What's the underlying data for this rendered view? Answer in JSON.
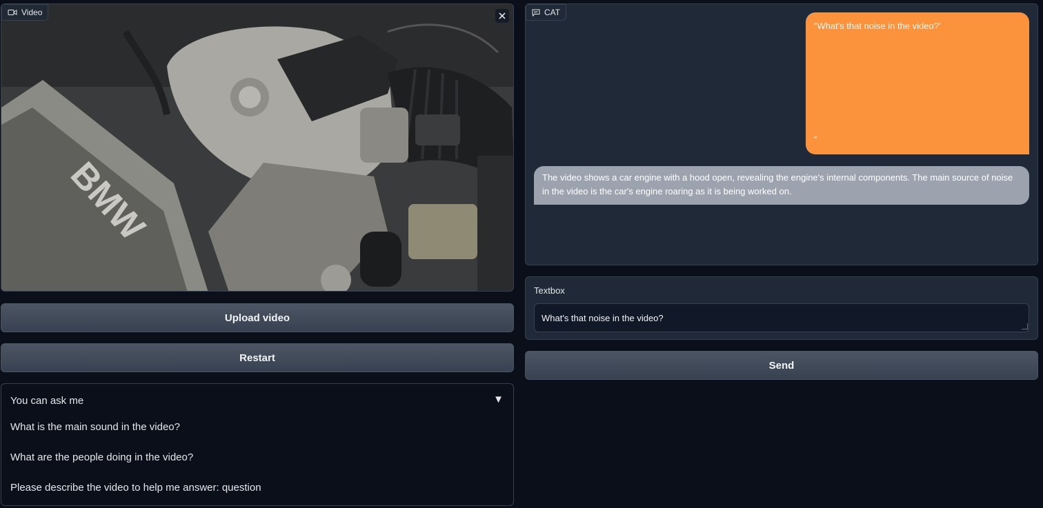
{
  "video": {
    "label": "Video",
    "brand_text": "BMW"
  },
  "left": {
    "upload_label": "Upload video",
    "restart_label": "Restart"
  },
  "examples": {
    "title": "You can ask me",
    "items": [
      "What is the main sound in the video?",
      "What are the people doing in the video?",
      "Please describe the video to help me answer: question"
    ]
  },
  "chat": {
    "label": "CAT",
    "user_message": "“What's that noise in the video?'",
    "user_message_end": "”",
    "bot_line1": "The video shows a car engine with a hood open, revealing the engine's internal components. The main source of noise",
    "bot_line2": "in the video is the car's engine roaring as it is being worked on."
  },
  "textbox": {
    "label": "Textbox",
    "value": "What's that noise in the video?"
  },
  "send_label": "Send",
  "colors": {
    "background": "#0b0f19",
    "panel": "#1f2937",
    "user_bubble": "#fb923c",
    "bot_bubble": "#9ca3af"
  }
}
